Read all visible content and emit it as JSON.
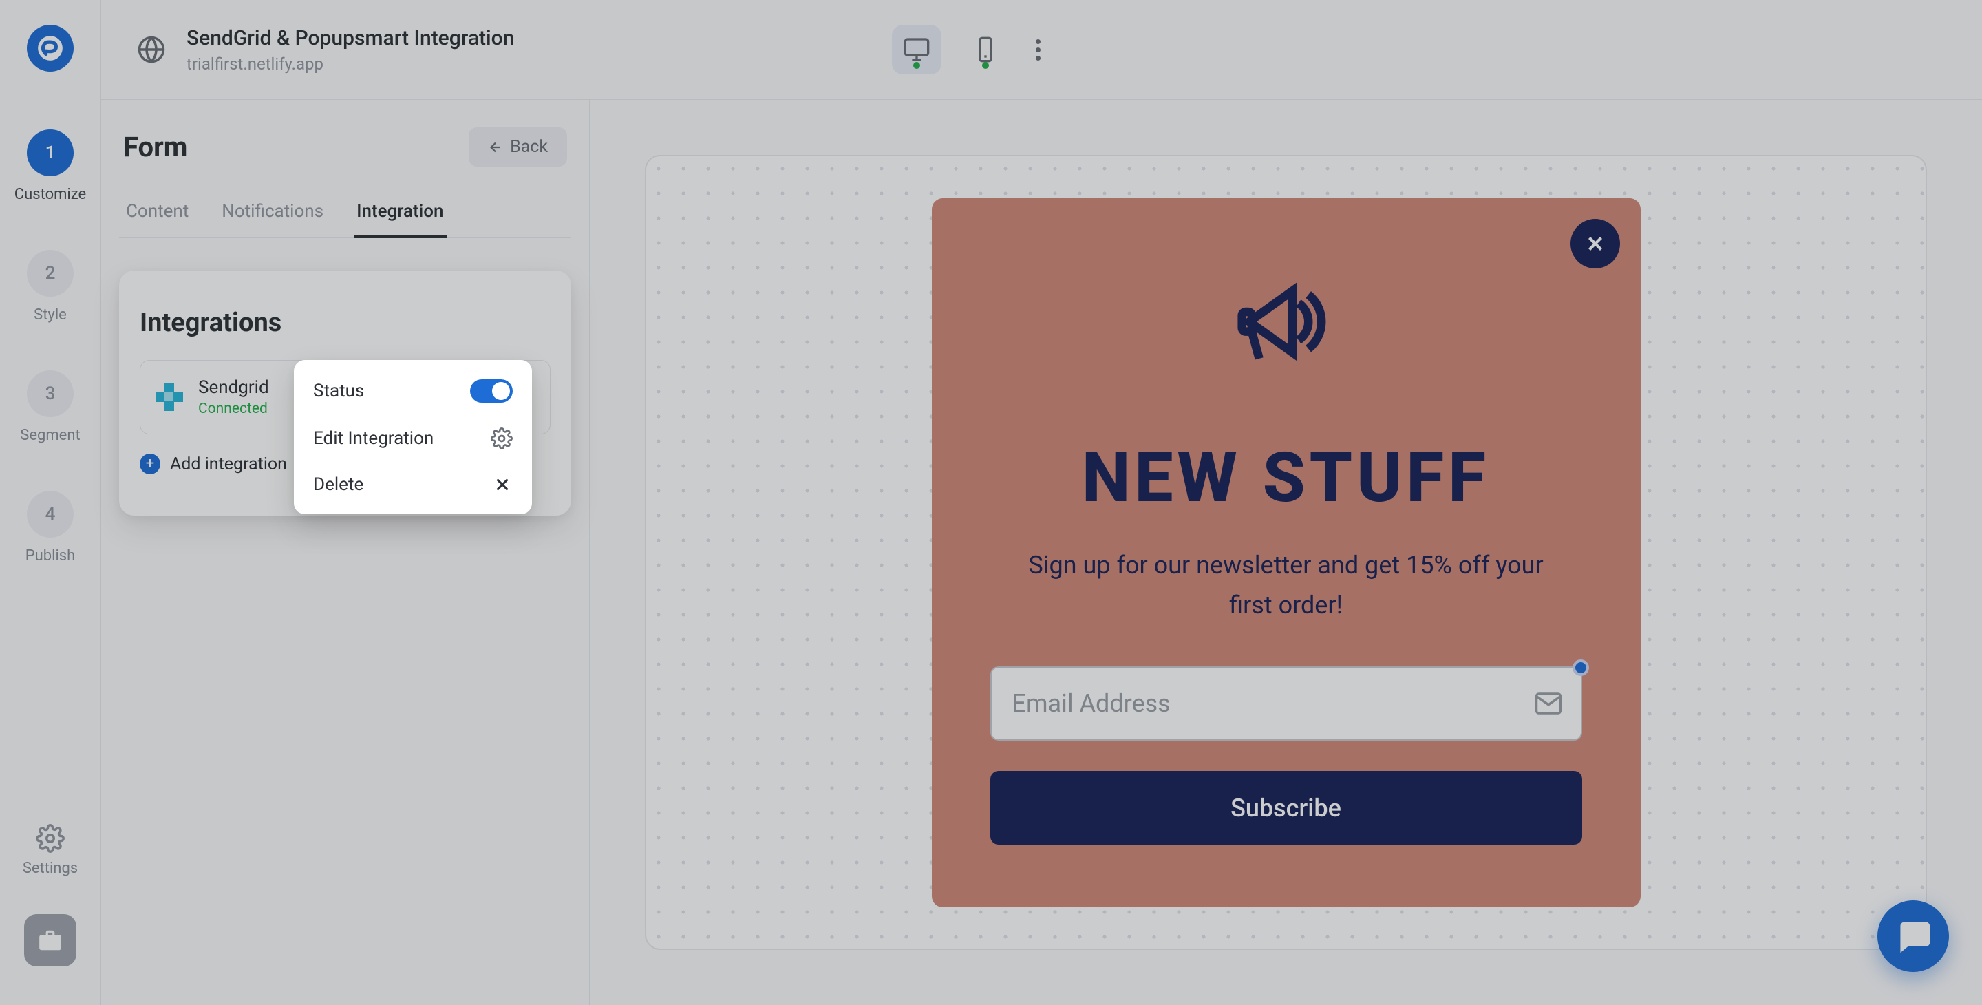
{
  "header": {
    "title": "SendGrid & Popupsmart Integration",
    "subtitle": "trialfirst.netlify.app"
  },
  "steps": [
    {
      "num": "1",
      "label": "Customize",
      "active": true
    },
    {
      "num": "2",
      "label": "Style",
      "active": false
    },
    {
      "num": "3",
      "label": "Segment",
      "active": false
    },
    {
      "num": "4",
      "label": "Publish",
      "active": false
    }
  ],
  "rail": {
    "settings": "Settings"
  },
  "panel": {
    "title": "Form",
    "back": "Back",
    "tabs": [
      {
        "label": "Content",
        "active": false
      },
      {
        "label": "Notifications",
        "active": false
      },
      {
        "label": "Integration",
        "active": true
      }
    ],
    "card_title": "Integrations",
    "integration": {
      "name": "Sendgrid",
      "status": "Connected"
    },
    "add_label": "Add integration",
    "dropdown": {
      "status": "Status",
      "edit": "Edit Integration",
      "delete": "Delete"
    }
  },
  "popup": {
    "headline": "NEW STUFF",
    "subhead": "Sign up for our newsletter and get 15% off your first order!",
    "placeholder": "Email Address",
    "cta": "Subscribe"
  }
}
